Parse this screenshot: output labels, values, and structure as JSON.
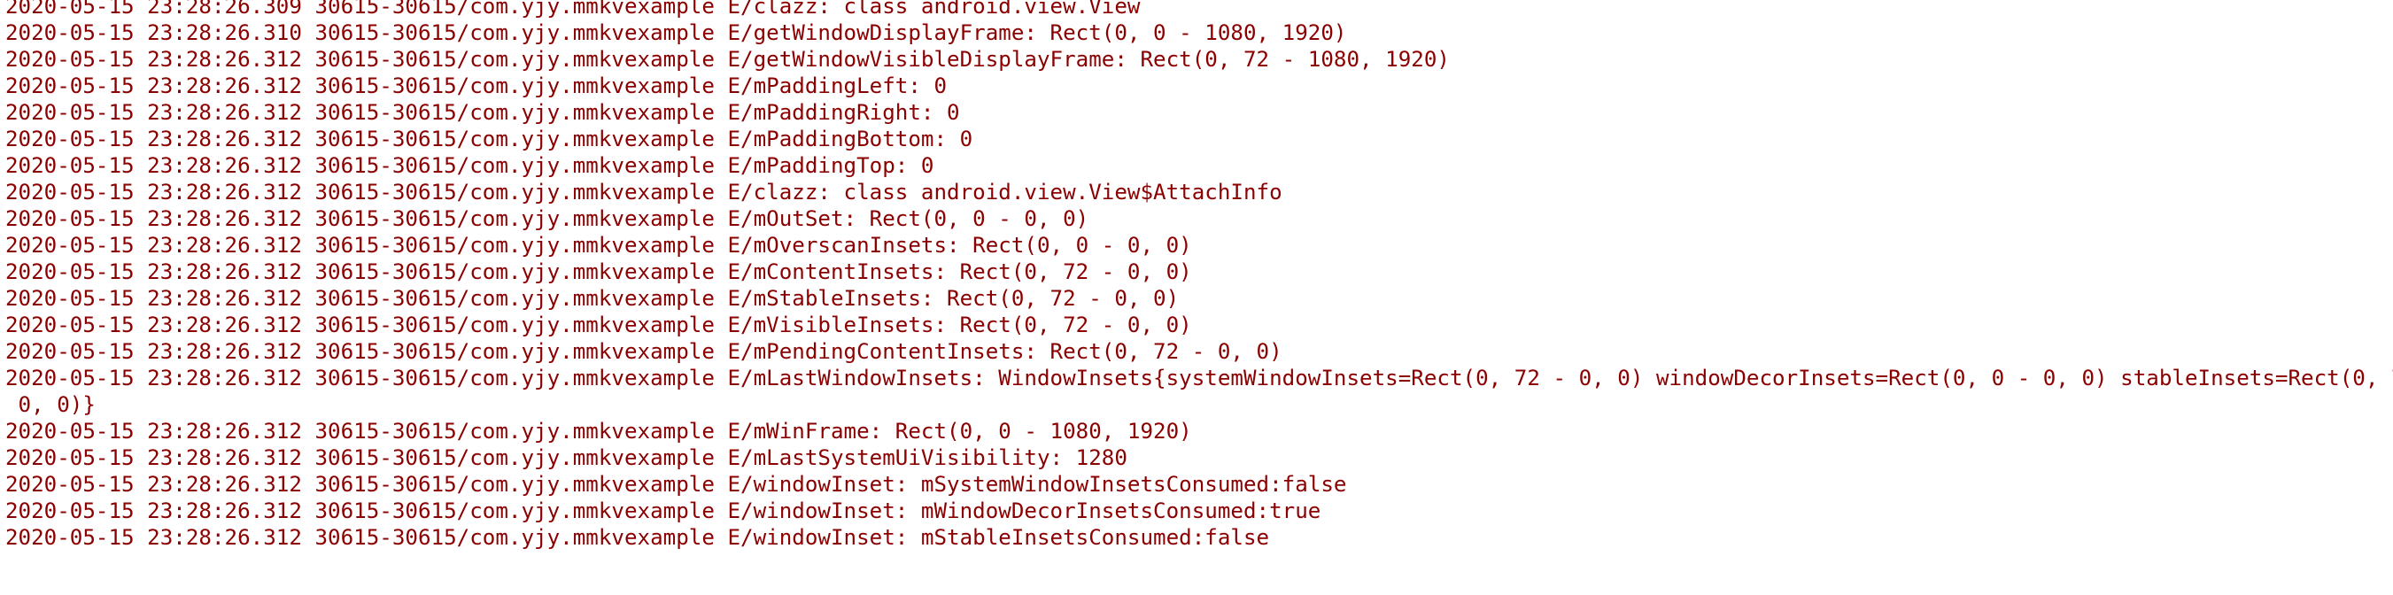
{
  "log": {
    "lines": [
      "2020-05-15 23:28:26.309 30615-30615/com.yjy.mmkvexample E/clazz: class android.view.View",
      "2020-05-15 23:28:26.310 30615-30615/com.yjy.mmkvexample E/getWindowDisplayFrame: Rect(0, 0 - 1080, 1920)",
      "2020-05-15 23:28:26.312 30615-30615/com.yjy.mmkvexample E/getWindowVisibleDisplayFrame: Rect(0, 72 - 1080, 1920)",
      "2020-05-15 23:28:26.312 30615-30615/com.yjy.mmkvexample E/mPaddingLeft: 0",
      "2020-05-15 23:28:26.312 30615-30615/com.yjy.mmkvexample E/mPaddingRight: 0",
      "2020-05-15 23:28:26.312 30615-30615/com.yjy.mmkvexample E/mPaddingBottom: 0",
      "2020-05-15 23:28:26.312 30615-30615/com.yjy.mmkvexample E/mPaddingTop: 0",
      "2020-05-15 23:28:26.312 30615-30615/com.yjy.mmkvexample E/clazz: class android.view.View$AttachInfo",
      "2020-05-15 23:28:26.312 30615-30615/com.yjy.mmkvexample E/mOutSet: Rect(0, 0 - 0, 0)",
      "2020-05-15 23:28:26.312 30615-30615/com.yjy.mmkvexample E/mOverscanInsets: Rect(0, 0 - 0, 0)",
      "2020-05-15 23:28:26.312 30615-30615/com.yjy.mmkvexample E/mContentInsets: Rect(0, 72 - 0, 0)",
      "2020-05-15 23:28:26.312 30615-30615/com.yjy.mmkvexample E/mStableInsets: Rect(0, 72 - 0, 0)",
      "2020-05-15 23:28:26.312 30615-30615/com.yjy.mmkvexample E/mVisibleInsets: Rect(0, 72 - 0, 0)",
      "2020-05-15 23:28:26.312 30615-30615/com.yjy.mmkvexample E/mPendingContentInsets: Rect(0, 72 - 0, 0)",
      "2020-05-15 23:28:26.312 30615-30615/com.yjy.mmkvexample E/mLastWindowInsets: WindowInsets{systemWindowInsets=Rect(0, 72 - 0, 0) windowDecorInsets=Rect(0, 0 - 0, 0) stableInsets=Rect(0, 72 -",
      " 0, 0)}",
      "2020-05-15 23:28:26.312 30615-30615/com.yjy.mmkvexample E/mWinFrame: Rect(0, 0 - 1080, 1920)",
      "2020-05-15 23:28:26.312 30615-30615/com.yjy.mmkvexample E/mLastSystemUiVisibility: 1280",
      "2020-05-15 23:28:26.312 30615-30615/com.yjy.mmkvexample E/windowInset: mSystemWindowInsetsConsumed:false",
      "2020-05-15 23:28:26.312 30615-30615/com.yjy.mmkvexample E/windowInset: mWindowDecorInsetsConsumed:true",
      "2020-05-15 23:28:26.312 30615-30615/com.yjy.mmkvexample E/windowInset: mStableInsetsConsumed:false"
    ],
    "text_color": "#8b0000",
    "background": "#ffffff"
  }
}
